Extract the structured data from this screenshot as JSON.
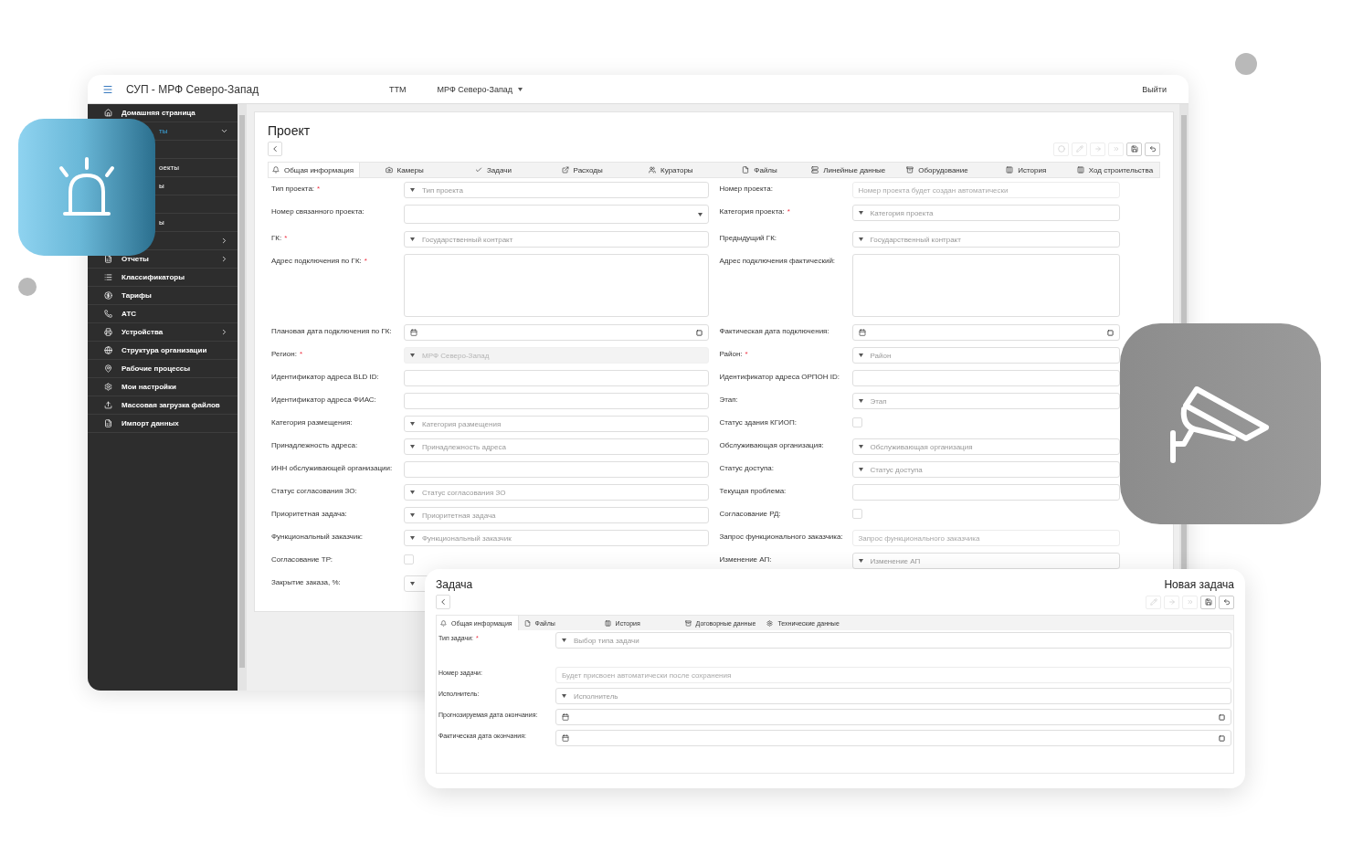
{
  "header": {
    "title": "СУП - МРФ Северо-Запад",
    "nav": "ТТМ",
    "region": "МРФ Северо-Запад",
    "logout": "Выйти"
  },
  "sidebar": {
    "items": [
      {
        "label": "Домашняя страница",
        "kind": "full",
        "selected": false
      },
      {
        "label": "ты",
        "kind": "covered",
        "selected": true,
        "expanded": true
      },
      {
        "kind": "covered"
      },
      {
        "label": "оекты",
        "kind": "covered",
        "selected": false
      },
      {
        "label": "ы",
        "kind": "covered",
        "selected": false
      },
      {
        "kind": "covered"
      },
      {
        "label": "ы",
        "kind": "covered",
        "selected": false
      },
      {
        "kind": "covered",
        "expanded": false
      },
      {
        "label": "Отчеты",
        "kind": "full",
        "selected": false,
        "expanded": false
      },
      {
        "label": "Классификаторы",
        "kind": "full",
        "selected": false
      },
      {
        "label": "Тарифы",
        "kind": "full",
        "selected": false
      },
      {
        "label": "АТС",
        "kind": "full",
        "selected": false
      },
      {
        "label": "Устройства",
        "kind": "full",
        "selected": false,
        "expanded": false
      },
      {
        "label": "Структура организации",
        "kind": "full",
        "selected": false
      },
      {
        "label": "Рабочие процессы",
        "kind": "full",
        "selected": false
      },
      {
        "label": "Мои настройки",
        "kind": "full",
        "selected": false
      },
      {
        "label": "Массовая загрузка файлов",
        "kind": "full",
        "selected": false
      },
      {
        "label": "Импорт данных",
        "kind": "full",
        "selected": false
      }
    ]
  },
  "project": {
    "title": "Проект",
    "toolbar": [
      {
        "disabled": true
      },
      {
        "disabled": true
      },
      {
        "disabled": true
      },
      {
        "disabled": true
      },
      {
        "disabled": false
      },
      {
        "disabled": false
      }
    ],
    "tabs": [
      {
        "label": "Общая информация",
        "selected": true
      },
      {
        "label": "Камеры",
        "selected": false
      },
      {
        "label": "Задачи",
        "selected": false
      },
      {
        "label": "Расходы",
        "selected": false
      },
      {
        "label": "Кураторы",
        "selected": false
      },
      {
        "label": "Файлы",
        "selected": false
      },
      {
        "label": "Линейные данные",
        "selected": false
      },
      {
        "label": "Оборудование",
        "selected": false
      },
      {
        "label": "История",
        "selected": false
      },
      {
        "label": "Ход строительства",
        "selected": false
      }
    ],
    "left": [
      {
        "label": "Тип проекта:",
        "asterisk": "*",
        "kind": "select",
        "placeholder": "Тип проекта",
        "disabled": false
      },
      {
        "label": "Номер связанного проекта:",
        "kind": "select-end",
        "disabled": false
      },
      {
        "label": "ГК:",
        "asterisk": "*",
        "kind": "select",
        "placeholder": "Государственный контракт",
        "disabled": false
      },
      {
        "label": "Адрес подключения по ГК:",
        "asterisk": "*",
        "kind": "textarea",
        "disabled": false
      },
      {
        "label": "Плановая дата подключения по ГК:",
        "kind": "date",
        "disabled": false
      },
      {
        "label": "Регион:",
        "asterisk": "*",
        "kind": "select",
        "value": "МРФ Северо-Запад",
        "disabled": true
      },
      {
        "label": "Идентификатор адреса BLD ID:",
        "kind": "input",
        "disabled": false
      },
      {
        "label": "Идентификатор адреса ФИАС:",
        "kind": "input",
        "disabled": false
      },
      {
        "label": "Категория размещения:",
        "kind": "select",
        "placeholder": "Категория размещения",
        "disabled": false
      },
      {
        "label": "Принадлежность адреса:",
        "kind": "select",
        "placeholder": "Принадлежность адреса",
        "disabled": false
      },
      {
        "label": "ИНН обслуживающей организации:",
        "kind": "input",
        "disabled": false
      },
      {
        "label": "Статус согласования ЗО:",
        "kind": "select",
        "placeholder": "Статус согласования ЗО",
        "disabled": false
      },
      {
        "label": "Приоритетная задача:",
        "kind": "select",
        "placeholder": "Приоритетная задача",
        "disabled": false
      },
      {
        "label": "Функциональный заказчик:",
        "kind": "select",
        "placeholder": "Функциональный заказчик",
        "disabled": false
      },
      {
        "label": "Согласование ТР:",
        "kind": "checkbox",
        "checked": false,
        "disabled": false
      },
      {
        "label": "Закрытие заказа, %:",
        "kind": "select",
        "disabled": false
      }
    ],
    "right": [
      {
        "label": "Номер проекта:",
        "kind": "input",
        "placeholder": "Номер проекта будет создан автоматически",
        "disabled": false
      },
      {
        "label": "Категория проекта:",
        "asterisk": "*",
        "kind": "select",
        "placeholder": "Категория проекта",
        "disabled": false
      },
      {
        "label": "Предыдущий ГК:",
        "kind": "select",
        "placeholder": "Государственный контракт",
        "disabled": false
      },
      {
        "label": "Адрес подключения фактический:",
        "kind": "textarea",
        "disabled": false
      },
      {
        "label": "Фактическая дата подключения:",
        "kind": "date",
        "disabled": false
      },
      {
        "label": "Район:",
        "asterisk": "*",
        "kind": "select",
        "placeholder": "Район",
        "disabled": false
      },
      {
        "label": "Идентификатор адреса ОРПОН ID:",
        "kind": "input",
        "disabled": false
      },
      {
        "label": "Этап:",
        "kind": "select",
        "placeholder": "Этап",
        "disabled": false
      },
      {
        "label": "Статус здания КГИОП:",
        "kind": "checkbox",
        "checked": false,
        "disabled": false
      },
      {
        "label": "Обслуживающая организация:",
        "kind": "select",
        "placeholder": "Обслуживающая организация",
        "disabled": false
      },
      {
        "label": "Статус доступа:",
        "kind": "select",
        "placeholder": "Статус доступа",
        "disabled": false
      },
      {
        "label": "Текущая проблема:",
        "kind": "input",
        "disabled": false
      },
      {
        "label": "Согласование РД:",
        "kind": "checkbox",
        "checked": false,
        "disabled": false
      },
      {
        "label": "Запрос функционального заказчика:",
        "kind": "input",
        "placeholder": "Запрос функционального заказчика",
        "disabled": false
      },
      {
        "label": "Изменение АП:",
        "kind": "select",
        "placeholder": "Изменение АП",
        "disabled": false
      }
    ]
  },
  "task": {
    "title": "Задача",
    "subtitle": "Новая задача",
    "toolbar": [
      {
        "disabled": true
      },
      {
        "disabled": true
      },
      {
        "disabled": true
      },
      {
        "disabled": false
      },
      {
        "disabled": false
      }
    ],
    "tabs": [
      {
        "label": "Общая информация",
        "selected": true
      },
      {
        "label": "Файлы",
        "selected": false
      },
      {
        "label": "История",
        "selected": false
      },
      {
        "label": "Договорные данные",
        "selected": false
      },
      {
        "label": "Технические данные",
        "selected": false
      }
    ],
    "fields": [
      {
        "label": "Тип задачи:",
        "asterisk": "*",
        "kind": "select",
        "placeholder": "Выбор типа задачи"
      },
      {
        "label": "Номер задачи:",
        "kind": "input",
        "placeholder": "Будет присвоен автоматически после сохранения"
      },
      {
        "label": "Исполнитель:",
        "kind": "select",
        "placeholder": "Исполнитель"
      },
      {
        "label": "Прогнозируемая дата окончания:",
        "kind": "date"
      },
      {
        "label": "Фактическая дата окончания:",
        "kind": "date"
      }
    ]
  }
}
